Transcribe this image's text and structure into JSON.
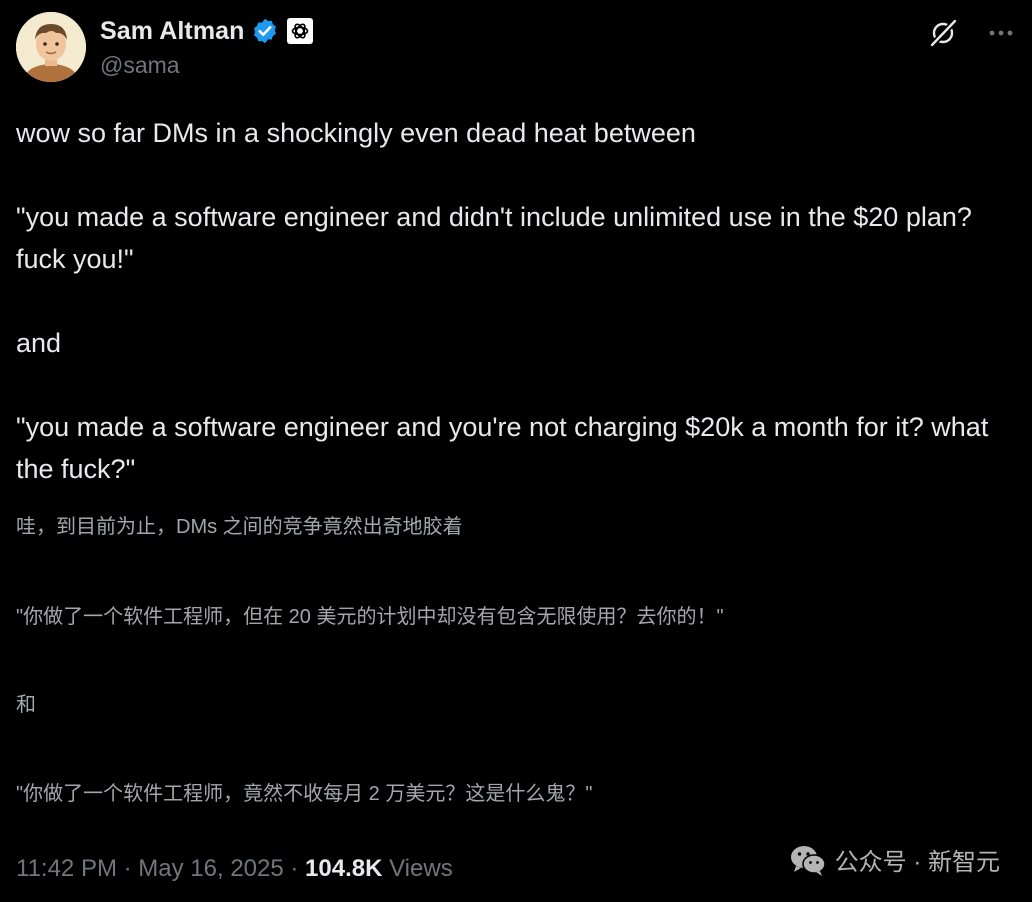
{
  "author": {
    "display_name": "Sam Altman",
    "handle": "@sama",
    "verified_icon": "verified-badge-icon",
    "affiliation_icon": "openai-logo-icon"
  },
  "actions": {
    "grok_icon": "grok-icon",
    "more_icon": "more-options-icon"
  },
  "tweet": {
    "line1": "wow so far DMs in a shockingly even dead heat between",
    "line2": "\"you made a software engineer and didn't include unlimited use in the $20 plan? fuck you!\"",
    "line3": "and",
    "line4": "\"you made a software engineer and you're not charging $20k a month for it? what the fuck?\""
  },
  "translation": {
    "line1": "哇，到目前为止，DMs 之间的竞争竟然出奇地胶着",
    "line2": "\"你做了一个软件工程师，但在 20 美元的计划中却没有包含无限使用？去你的！\"",
    "line3": "和",
    "line4": "\"你做了一个软件工程师，竟然不收每月 2 万美元？这是什么鬼？\""
  },
  "meta": {
    "time": "11:42 PM",
    "sep1": " · ",
    "date": "May 16, 2025",
    "sep2": " · ",
    "views_count": "104.8K",
    "views_label": " Views"
  },
  "watermark": {
    "text": "公众号 · 新智元",
    "icon": "wechat-icon"
  },
  "colors": {
    "background": "#000000",
    "primary_text": "#e7e9ea",
    "secondary_text": "#71767b",
    "verified_blue": "#1d9bf0"
  }
}
